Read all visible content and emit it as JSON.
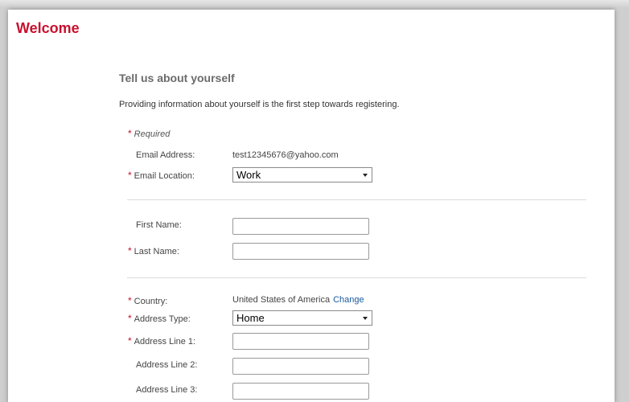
{
  "page": {
    "title": "Welcome"
  },
  "section": {
    "title": "Tell us about yourself",
    "intro": "Providing information about yourself is the first step towards registering.",
    "required_note": "Required"
  },
  "form": {
    "email_address": {
      "label": "Email Address:",
      "value": "test12345676@yahoo.com"
    },
    "email_location": {
      "label": "Email Location:",
      "value": "Work",
      "required": true
    },
    "first_name": {
      "label": "First Name:",
      "value": ""
    },
    "last_name": {
      "label": "Last Name:",
      "value": "",
      "required": true
    },
    "country": {
      "label": "Country:",
      "value": "United States of America",
      "action": "Change",
      "required": true
    },
    "address_type": {
      "label": "Address Type:",
      "value": "Home",
      "required": true
    },
    "address_line_1": {
      "label": "Address Line 1:",
      "value": "",
      "required": true
    },
    "address_line_2": {
      "label": "Address Line 2:",
      "value": ""
    },
    "address_line_3": {
      "label": "Address Line 3:",
      "value": ""
    }
  },
  "colors": {
    "brand_red": "#c8102e",
    "link_blue": "#1a5a9c",
    "title_gray": "#6b6b6b"
  },
  "icons": {
    "required": "asterisk-icon",
    "dropdown": "chevron-down-icon"
  }
}
